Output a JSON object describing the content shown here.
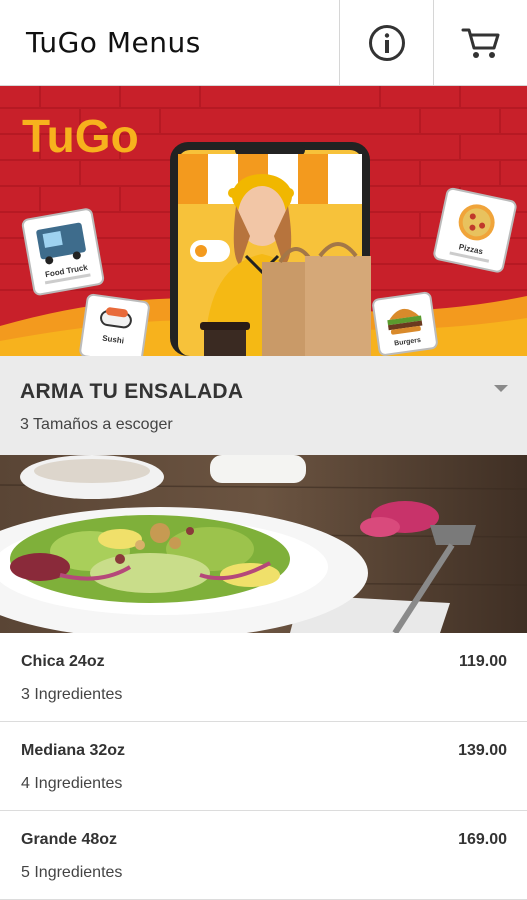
{
  "header": {
    "title": "TuGo Menus",
    "info_icon": "info-icon",
    "cart_icon": "cart-icon"
  },
  "banner": {
    "brand": "TuGo",
    "cards": [
      {
        "label": "Food Truck",
        "icon": "truck-icon"
      },
      {
        "label": "Pizzas",
        "icon": "pizza-icon"
      },
      {
        "label": "Sushi",
        "icon": "sushi-icon"
      },
      {
        "label": "Burgers",
        "icon": "burger-icon"
      }
    ],
    "colors": {
      "red": "#c8202a",
      "yellow": "#f7b21d",
      "orange": "#f39a1e"
    }
  },
  "section": {
    "title": "ARMA TU ENSALADA",
    "subtitle": "3 Tamaños a escoger",
    "expand_icon": "caret-down-icon"
  },
  "sizes": [
    {
      "name": "Chica 24oz",
      "desc": "3 Ingredientes",
      "price": "119.00"
    },
    {
      "name": "Mediana 32oz",
      "desc": "4 Ingredientes",
      "price": "139.00"
    },
    {
      "name": "Grande 48oz",
      "desc": "5 Ingredientes",
      "price": "169.00"
    }
  ]
}
